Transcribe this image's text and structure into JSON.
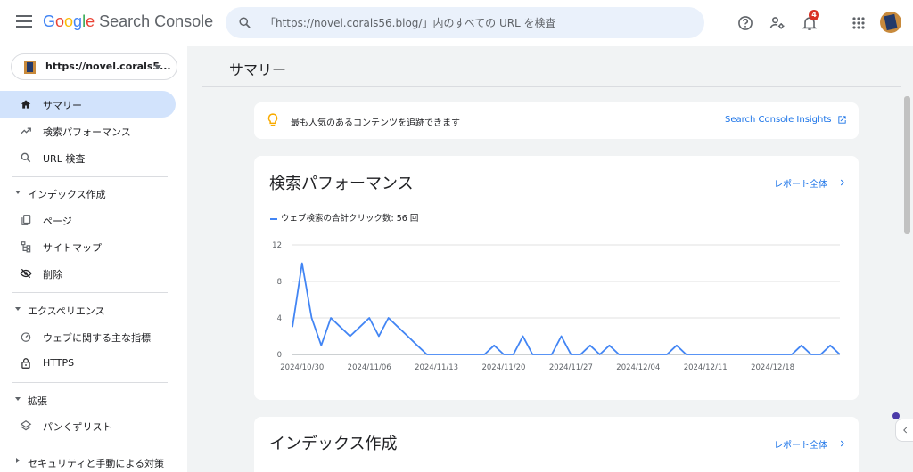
{
  "header": {
    "logo_letters": [
      "G",
      "o",
      "o",
      "g",
      "l",
      "e"
    ],
    "product": "Search Console",
    "search_placeholder": "「https://novel.corals56.blog/」内のすべての URL を検査",
    "notification_count": "4",
    "icons": [
      "menu-icon",
      "search-icon",
      "help-icon",
      "manage-users-icon",
      "bell-icon",
      "apps-icon"
    ]
  },
  "sidebar": {
    "property": "https://novel.corals5...",
    "items": [
      {
        "label": "サマリー",
        "icon": "home-icon",
        "active": true
      },
      {
        "label": "検索パフォーマンス",
        "icon": "trending-up-icon",
        "active": false
      },
      {
        "label": "URL 検査",
        "icon": "search-icon",
        "active": false
      }
    ],
    "sections": [
      {
        "label": "インデックス作成",
        "items": [
          {
            "label": "ページ",
            "icon": "pages-icon"
          },
          {
            "label": "サイトマップ",
            "icon": "sitemap-icon"
          },
          {
            "label": "削除",
            "icon": "visibility-off-icon"
          }
        ]
      },
      {
        "label": "エクスペリエンス",
        "items": [
          {
            "label": "ウェブに関する主な指標",
            "icon": "speed-icon"
          },
          {
            "label": "HTTPS",
            "icon": "lock-icon"
          }
        ]
      },
      {
        "label": "拡張",
        "items": [
          {
            "label": "パンくずリスト",
            "icon": "layers-icon"
          }
        ]
      },
      {
        "label": "セキュリティと手動による対策",
        "items": []
      }
    ]
  },
  "main": {
    "page_title": "サマリー",
    "insights": {
      "text": "最も人気のあるコンテンツを追跡できます",
      "link": "Search Console Insights"
    },
    "performance": {
      "title": "検索パフォーマンス",
      "report_link": "レポート全体",
      "legend": "ウェブ検索の合計クリック数: 56 回"
    },
    "indexing": {
      "title": "インデックス作成",
      "report_link": "レポート全体"
    }
  },
  "chart_data": {
    "type": "line",
    "series": [
      {
        "name": "ウェブ検索の合計クリック数",
        "color": "#4285f4",
        "values": [
          3,
          10,
          4,
          1,
          4,
          3,
          2,
          3,
          4,
          2,
          4,
          3,
          2,
          1,
          0,
          0,
          0,
          0,
          0,
          0,
          0,
          1,
          0,
          0,
          2,
          0,
          0,
          0,
          2,
          0,
          0,
          1,
          0,
          1,
          0,
          0,
          0,
          0,
          0,
          0,
          1,
          0,
          0,
          0,
          0,
          0,
          0,
          0,
          0,
          0,
          0,
          0,
          0,
          1,
          0,
          0,
          1,
          0
        ]
      }
    ],
    "x_start": "2024/10/29",
    "x_ticks": [
      "2024/10/30",
      "2024/11/06",
      "2024/11/13",
      "2024/11/20",
      "2024/11/27",
      "2024/12/04",
      "2024/12/11",
      "2024/12/18"
    ],
    "y_ticks": [
      "0",
      "4",
      "8",
      "12"
    ],
    "ylim": [
      0,
      12
    ],
    "grid": true
  }
}
